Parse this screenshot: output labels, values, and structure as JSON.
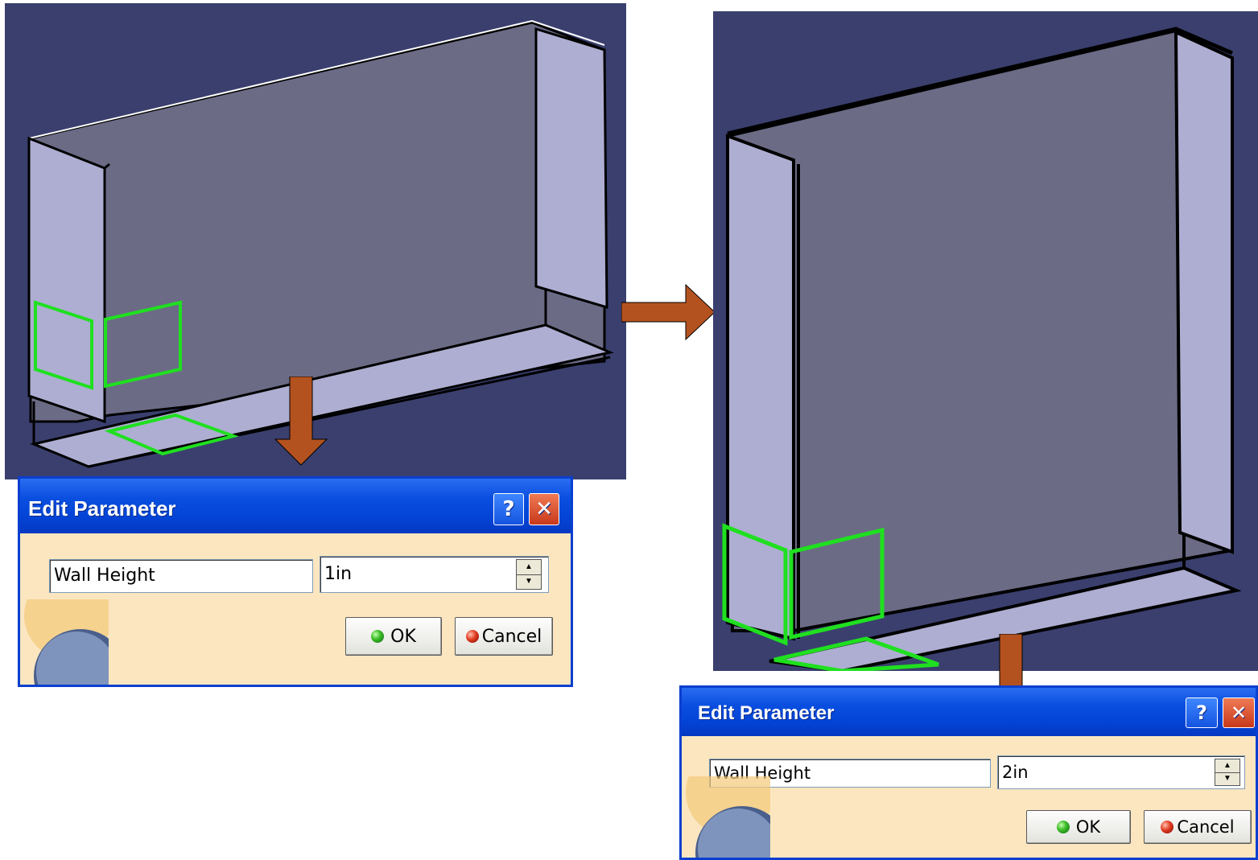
{
  "colors": {
    "viewport_bg": "#3a3f6e",
    "wall": "#6a6a85",
    "flange": "#aeaed2",
    "highlight": "#1fe01f",
    "arrow": "#b4521f",
    "dialog_bg": "#fbe6c0",
    "titlebar": "#0a4fe0"
  },
  "dialog_left": {
    "title": "Edit Parameter",
    "help_label": "?",
    "close_label": "✕",
    "name_value": "Wall Height",
    "value": "1in",
    "ok_label": "OK",
    "cancel_label": "Cancel"
  },
  "dialog_right": {
    "title": "Edit Parameter",
    "help_label": "?",
    "close_label": "✕",
    "name_value": "Wall Height",
    "value": "2in",
    "ok_label": "OK",
    "cancel_label": "Cancel"
  },
  "icons": {
    "spin_up": "▲",
    "spin_down": "▼",
    "ok_icon": "green-ball-icon",
    "cancel_icon": "red-ball-icon"
  }
}
